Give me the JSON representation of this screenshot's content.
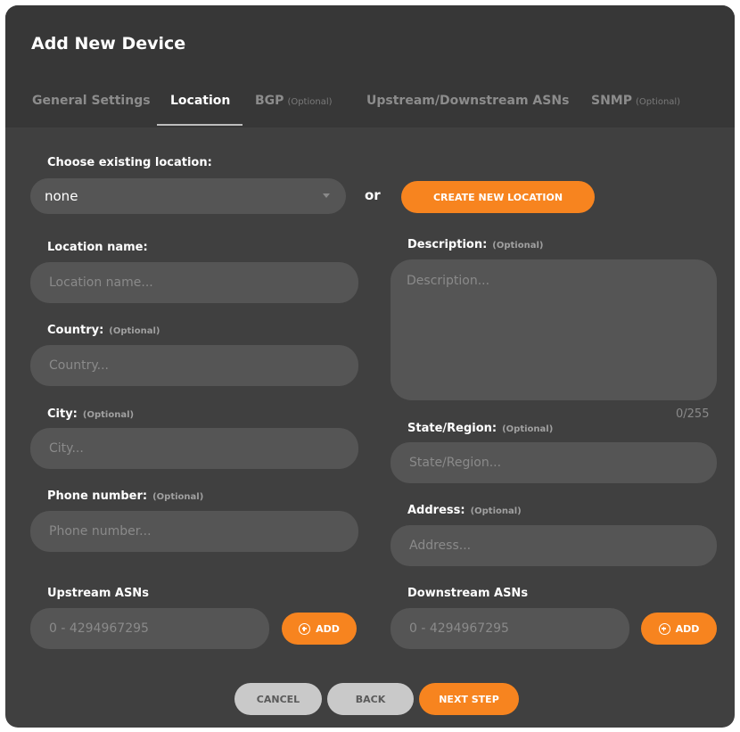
{
  "dialog": {
    "title": "Add New Device"
  },
  "tabs": [
    {
      "label": "General Settings",
      "optional": ""
    },
    {
      "label": "Location",
      "optional": ""
    },
    {
      "label": "BGP",
      "optional": "(Optional)"
    },
    {
      "label": "Upstream/Downstream ASNs",
      "optional": ""
    },
    {
      "label": "SNMP",
      "optional": "(Optional)"
    }
  ],
  "active_tab": "Location",
  "existing_location": {
    "label": "Choose existing location:",
    "value": "none"
  },
  "or_text": "or",
  "create_button": "CREATE NEW LOCATION",
  "optional_tag": "(Optional)",
  "fields": {
    "location_name": {
      "label": "Location name:",
      "placeholder": "Location name..."
    },
    "country": {
      "label": "Country:",
      "placeholder": "Country..."
    },
    "city": {
      "label": "City:",
      "placeholder": "City..."
    },
    "phone": {
      "label": "Phone number:",
      "placeholder": "Phone number..."
    },
    "description": {
      "label": "Description:",
      "placeholder": "Description...",
      "counter": "0/255"
    },
    "state": {
      "label": "State/Region:",
      "placeholder": "State/Region..."
    },
    "address": {
      "label": "Address:",
      "placeholder": "Address..."
    },
    "upstream": {
      "label": "Upstream ASNs",
      "placeholder": "0 - 4294967295",
      "button": "ADD"
    },
    "downstream": {
      "label": "Downstream ASNs",
      "placeholder": "0 - 4294967295",
      "button": "ADD"
    }
  },
  "footer": {
    "cancel": "CANCEL",
    "back": "BACK",
    "next": "NEXT STEP"
  },
  "colors": {
    "accent": "#f7841f",
    "panel": "#404040",
    "header": "#373737",
    "input": "#555555"
  }
}
